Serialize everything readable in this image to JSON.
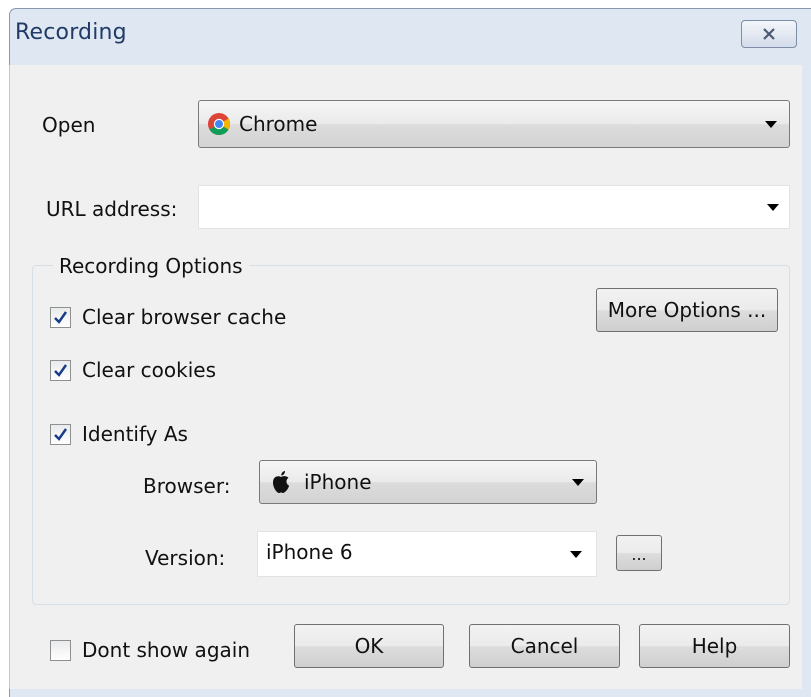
{
  "dialog": {
    "title": "Recording"
  },
  "open": {
    "label": "Open",
    "selected": "Chrome",
    "icon": "chrome-icon"
  },
  "url": {
    "label": "URL address:",
    "value": ""
  },
  "options": {
    "group_title": "Recording Options",
    "clear_cache": {
      "label": "Clear browser cache",
      "checked": true
    },
    "clear_cookies": {
      "label": "Clear cookies",
      "checked": true
    },
    "identify_as": {
      "label": "Identify As",
      "checked": true
    },
    "more_options_label": "More Options ...",
    "browser": {
      "label": "Browser:",
      "selected": "iPhone",
      "icon": "apple-icon"
    },
    "version": {
      "label": "Version:",
      "value": "iPhone 6",
      "ellipsis_label": "..."
    }
  },
  "footer": {
    "dont_show": {
      "label": "Dont show again",
      "checked": false
    },
    "ok_label": "OK",
    "cancel_label": "Cancel",
    "help_label": "Help"
  },
  "colors": {
    "check_mark": "#1a3c8c",
    "title_text": "#1f3b66"
  }
}
